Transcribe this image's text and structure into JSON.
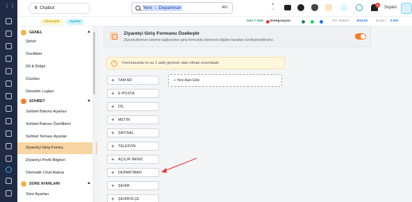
{
  "topbar": {
    "chatbot_label": "Chatbot",
    "chatbot_count": "0",
    "search_query": "Yeni → Departman",
    "search_shortcut": "⌘K",
    "user_name": "Supeis",
    "notification_count": "9",
    "badge_count": "8"
  },
  "subbar": {
    "plan_chip": "Ainesoyfe",
    "status_chip": "Ayarlar",
    "days_left": "Son 7 Gün",
    "integration": "Entegrasyon",
    "wp_label": "WP. Bakiye:",
    "wp_value": "4/10.00",
    "bugun_label": "Bugün:",
    "bugun_value": "5 Nis"
  },
  "sidebar": {
    "sections": [
      {
        "title": "GENEL",
        "items": [
          "Şirket",
          "Özellikler",
          "Dil & Bölge",
          "Cüzdan",
          "Denetim Logları"
        ]
      },
      {
        "title": "SOHBET",
        "items": [
          "Sohbet Balonu Ayarları",
          "Sohbet Balonu Özellikleri",
          "Sohbet Teması Ayarları",
          "Ziyaretçi Giriş Formu",
          "Ziyaretçi Profil Bilgileri",
          "Otomatik Chat Atama"
        ]
      },
      {
        "title": "SÜRE AYARLARI",
        "items": [
          "Süre Ayarları"
        ]
      }
    ],
    "active_item": "Ziyaretçi Giriş Formu"
  },
  "main": {
    "card_title": "Ziyaretçi Giriş Formunu Özelleştir",
    "card_subtitle": "Ziyaretçilerinize sisteme bağlanırken giriş formunda istenecek bilgileri buradan özelleştirebilirsiniz.",
    "toggle_on": true,
    "warning_text": "Formunuzda en az 1 adet görünür alan olmak zorundadır.",
    "fields": [
      "TAM AD",
      "E-POSTA",
      "DİL",
      "METİN",
      "SAYISAL",
      "TELEFON",
      "AÇILIR MENÜ",
      "DEPARTMAN",
      "ŞEHİR",
      "ŞEHİR/İLÇE"
    ],
    "drop_label": "+ Yeni Alan Ekle"
  },
  "colors": {
    "rail": "#1f2a44",
    "accent": "#f57c1f",
    "active_item": "#f7d6a3",
    "arrow": "#e53935"
  }
}
